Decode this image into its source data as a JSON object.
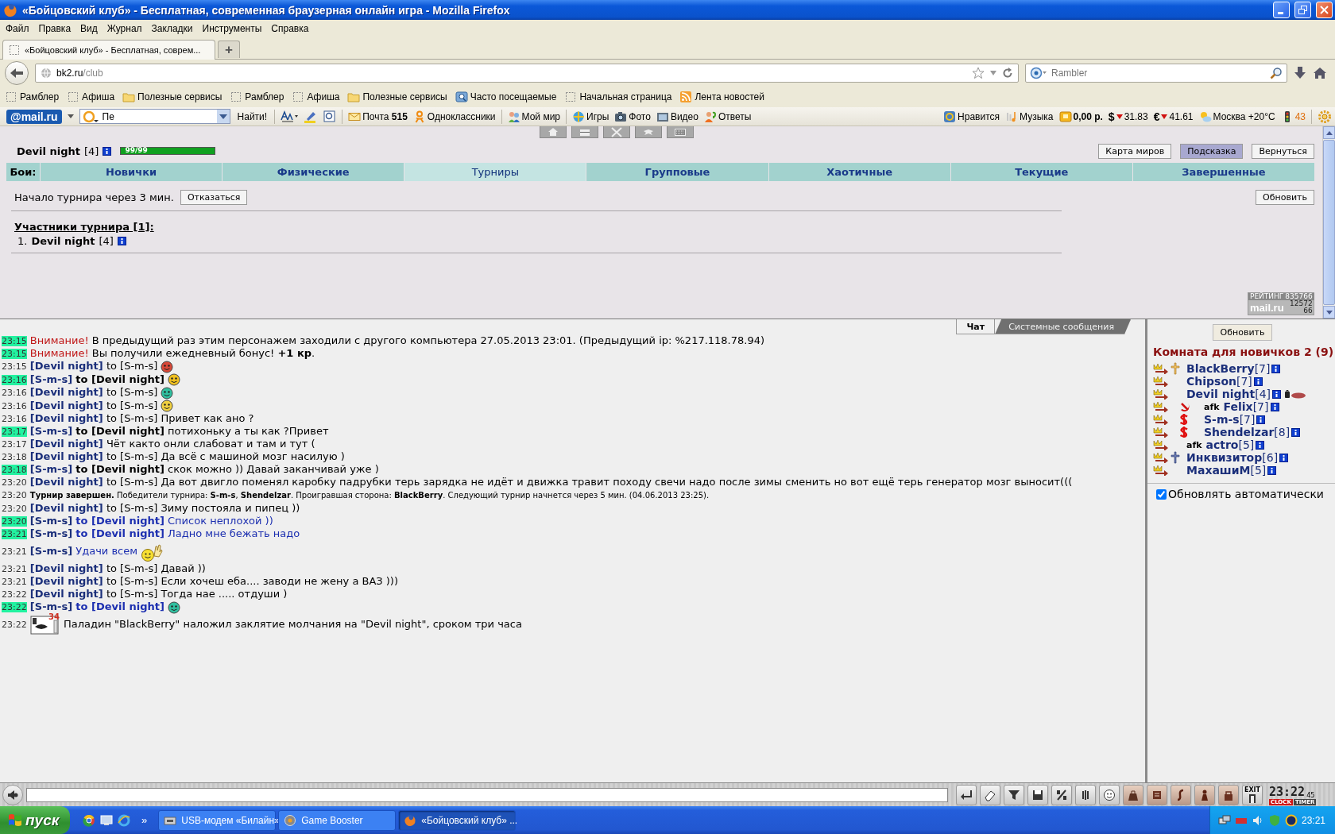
{
  "window": {
    "title": "«Бойцовский клуб» - Бесплатная, современная браузерная онлайн игра - Mozilla Firefox"
  },
  "menu": [
    "Файл",
    "Правка",
    "Вид",
    "Журнал",
    "Закладки",
    "Инструменты",
    "Справка"
  ],
  "tab": {
    "title": "«Бойцовский клуб» - Бесплатная, соврем...",
    "new_tab": "+"
  },
  "address": {
    "host": "bk2.ru",
    "path": "/club"
  },
  "search": {
    "placeholder": "Rambler"
  },
  "bookmarks": [
    {
      "label": "Рамблер",
      "kind": "page"
    },
    {
      "label": "Афиша",
      "kind": "page"
    },
    {
      "label": "Полезные сервисы",
      "kind": "folder"
    },
    {
      "label": "Рамблер",
      "kind": "page"
    },
    {
      "label": "Афиша",
      "kind": "page"
    },
    {
      "label": "Полезные сервисы",
      "kind": "folder"
    },
    {
      "label": "Часто посещаемые",
      "kind": "search"
    },
    {
      "label": "Начальная страница",
      "kind": "page"
    },
    {
      "label": "Лента новостей",
      "kind": "feed"
    }
  ],
  "mail_toolbar": {
    "logo": "@mail.ru",
    "query": "Пе",
    "find": "Найти!",
    "links": [
      {
        "label": "Почта **515**",
        "kind": "mail"
      },
      {
        "label": "Одноклассники",
        "kind": "ok"
      },
      {
        "label": "Мой мир",
        "kind": "world"
      },
      {
        "label": "Игры",
        "kind": "games"
      },
      {
        "label": "Фото",
        "kind": "photo"
      },
      {
        "label": "Видео",
        "kind": "video"
      },
      {
        "label": "Ответы",
        "kind": "answers"
      }
    ],
    "widgets": [
      {
        "label": "Нравится",
        "kind": "like"
      },
      {
        "label": "Музыка",
        "kind": "music"
      },
      {
        "label": "0,00 р.",
        "kind": "wallet"
      },
      {
        "label": "31.83",
        "kind": "currency",
        "symbol": "$"
      },
      {
        "label": "41.61",
        "kind": "currency",
        "symbol": "€"
      },
      {
        "label": "Москва +20°C",
        "kind": "weather"
      },
      {
        "label": "43",
        "kind": "traffic"
      }
    ]
  },
  "game": {
    "player": {
      "name": "Devil night",
      "level": "[4]"
    },
    "hp": {
      "reading": "99/99",
      "level": 1
    },
    "buttons": [
      {
        "label": "Карта миров",
        "selected": false
      },
      {
        "label": "Подсказка",
        "selected": true
      },
      {
        "label": "Вернуться",
        "selected": false
      }
    ],
    "fights_label": "Бои:",
    "fight_tabs": [
      {
        "label": "Новички",
        "selected": false
      },
      {
        "label": "Физические",
        "selected": false
      },
      {
        "label": "Турниры",
        "selected": true
      },
      {
        "label": "Групповые",
        "selected": false
      },
      {
        "label": "Хаотичные",
        "selected": false
      },
      {
        "label": "Текущие",
        "selected": false
      },
      {
        "label": "Завершенные",
        "selected": false
      }
    ],
    "notice": "Начало турнира через 3 мин.",
    "cancel": "Отказаться",
    "refresh": "Обновить",
    "participants_title": "Участники турнира [1]:",
    "participants": [
      {
        "number": "1.",
        "name": "Devil night",
        "level": "[4]"
      }
    ],
    "rating": {
      "label": "РЕЙТИНГ",
      "values": [
        "835766",
        "12572",
        "66"
      ],
      "logo": "mail.ru"
    }
  },
  "chat": {
    "tabs": [
      {
        "label": "Чат",
        "selected": true
      },
      {
        "label": "Системные сообщения",
        "selected": false
      }
    ],
    "messages": [
      {
        "time": "23:15",
        "time_marked": true,
        "kind": "warning",
        "label": "Внимание!",
        "text": "В предыдущий раз этим персонажем заходили с другого компьютера 27.05.2013 23:01. (Предыдущий ip: %217.118.78.94)"
      },
      {
        "time": "23:15",
        "time_marked": true,
        "kind": "warning",
        "label": "Внимание!",
        "text": "Вы получили ежедневный бонус! **+1 кр**."
      },
      {
        "time": "23:15",
        "time_marked": false,
        "kind": "message",
        "sender": "[Devil night]",
        "recipient": "to [S-m-s]",
        "recipient_bold": false,
        "color": "#000000",
        "smiley": {
          "kind": "face"
        }
      },
      {
        "time": "23:16",
        "time_marked": true,
        "kind": "message",
        "sender": "[S-m-s]",
        "recipient": "to [Devil night]",
        "recipient_bold": true,
        "color": "#000000",
        "smiley": {
          "kind": "face"
        }
      },
      {
        "time": "23:16",
        "time_marked": false,
        "kind": "message",
        "sender": "[Devil night]",
        "recipient": "to [S-m-s]",
        "recipient_bold": false,
        "color": "#000000",
        "smiley": {
          "kind": "face"
        }
      },
      {
        "time": "23:16",
        "time_marked": false,
        "kind": "message",
        "sender": "[Devil night]",
        "recipient": "to [S-m-s]",
        "recipient_bold": false,
        "color": "#000000",
        "smiley": {
          "kind": "face"
        }
      },
      {
        "time": "23:16",
        "time_marked": false,
        "kind": "message",
        "sender": "[Devil night]",
        "recipient": "to [S-m-s]",
        "recipient_bold": false,
        "color": "#000000",
        "text": "Привет как ано ?"
      },
      {
        "time": "23:17",
        "time_marked": true,
        "kind": "message",
        "sender": "[S-m-s]",
        "recipient": "to [Devil night]",
        "recipient_bold": true,
        "color": "#000000",
        "text": "потихоньку а ты как ?Привет"
      },
      {
        "time": "23:17",
        "time_marked": false,
        "kind": "message",
        "sender": "[Devil night]",
        "color": "#000000",
        "text": "Чёт както онли слабоват и там и тут ("
      },
      {
        "time": "23:18",
        "time_marked": false,
        "kind": "message",
        "sender": "[Devil night]",
        "recipient": "to [S-m-s]",
        "recipient_bold": false,
        "color": "#000000",
        "text": "Да всё с машиной мозг насилую )"
      },
      {
        "time": "23:18",
        "time_marked": true,
        "kind": "message",
        "sender": "[S-m-s]",
        "recipient": "to [Devil night]",
        "recipient_bold": true,
        "color": "#000000",
        "text": "скок можно )) Давай заканчивай уже )"
      },
      {
        "time": "23:20",
        "time_marked": false,
        "kind": "message",
        "sender": "[Devil night]",
        "recipient": "to [S-m-s]",
        "recipient_bold": false,
        "color": "#000000",
        "text": "Да вот двигло поменял каробку падрубки терь зарядка не идёт и движка травит походу свечи надо после зимы сменить но вот ещё терь генератор мозг выносит((("
      },
      {
        "time": "23:20",
        "time_marked": false,
        "kind": "tournament",
        "text": "**Турнир завершен.** Победители турнира: **S-m-s**, **Shendelzar**. Проигравшая сторона: **BlackBerry**. Следующий турнир начнется через 5 мин. (04.06.2013 23:25)."
      },
      {
        "time": "23:20",
        "time_marked": false,
        "kind": "message",
        "sender": "[Devil night]",
        "recipient": "to [S-m-s]",
        "recipient_bold": false,
        "color": "#000000",
        "text": "Зиму постояла и пипец ))"
      },
      {
        "time": "23:20",
        "time_marked": true,
        "kind": "message",
        "sender": "[S-m-s]",
        "recipient": "to [Devil night]",
        "recipient_bold": true,
        "color": "#1c2fb0",
        "text": "Список неплохой ))"
      },
      {
        "time": "23:21",
        "time_marked": true,
        "kind": "message",
        "sender": "[S-m-s]",
        "recipient": "to [Devil night]",
        "recipient_bold": true,
        "color": "#1c2fb0",
        "text": "Ладно мне бежать надо"
      },
      {
        "time": "23:21",
        "time_marked": false,
        "kind": "message",
        "sender": "[S-m-s]",
        "color": "#1c2fb0",
        "text": "Удачи всем",
        "smiley": {
          "kind": "wave"
        }
      },
      {
        "time": "23:21",
        "time_marked": false,
        "kind": "message",
        "sender": "[Devil night]",
        "recipient": "to [S-m-s]",
        "recipient_bold": false,
        "color": "#000000",
        "text": "Давай ))"
      },
      {
        "time": "23:21",
        "time_marked": false,
        "kind": "message",
        "sender": "[Devil night]",
        "recipient": "to [S-m-s]",
        "recipient_bold": false,
        "color": "#000000",
        "text": "Если хочеш еба.... заводи не жену а ВАЗ )))"
      },
      {
        "time": "23:22",
        "time_marked": false,
        "kind": "message",
        "sender": "[Devil night]",
        "recipient": "to [S-m-s]",
        "recipient_bold": false,
        "color": "#000000",
        "text": "Тогда нае ..... отдуши )"
      },
      {
        "time": "23:22",
        "time_marked": true,
        "kind": "message",
        "sender": "[S-m-s]",
        "recipient": "to [Devil night]",
        "recipient_bold": true,
        "color": "#1c2fb0",
        "smiley": {
          "kind": "face"
        }
      },
      {
        "time": "23:22",
        "time_marked": false,
        "kind": "spell",
        "badge": "34",
        "text": "Паладин \"BlackBerry\" наложил заклятие молчания на \"Devil night\", сроком три часа"
      }
    ]
  },
  "room": {
    "refresh": "Обновить",
    "title": "Комната для новичков 2 (9)",
    "users": [
      {
        "name": "BlackBerry",
        "level": "[7]",
        "kind": "light-cross",
        "silenced": false
      },
      {
        "name": "Chipson",
        "level": "[7]",
        "kind": "plain",
        "silenced": false
      },
      {
        "name": "Devil night",
        "level": "[4]",
        "kind": "plain",
        "silenced": true
      },
      {
        "name": "Felix",
        "level": "[7]",
        "kind": "sickle",
        "status": "afk",
        "silenced": false
      },
      {
        "name": "S-m-s",
        "level": "[7]",
        "kind": "dollar",
        "silenced": false
      },
      {
        "name": "Shendelzar",
        "level": "[8]",
        "kind": "dollar",
        "silenced": false
      },
      {
        "name": "actro",
        "level": "[5]",
        "kind": "plain",
        "status": "afk",
        "silenced": false
      },
      {
        "name": "Инквизитор",
        "level": "[6]",
        "kind": "dark-cross",
        "silenced": false
      },
      {
        "name": "МахашиМ",
        "level": "[5]",
        "kind": "plain",
        "silenced": false
      }
    ],
    "auto_refresh": {
      "label": "Обновлять автоматически",
      "checked": true
    }
  },
  "input_bar": {
    "exit": "EXIT",
    "clock": {
      "time": "23:22",
      "seconds": "45",
      "modes": [
        "CLOCK",
        "TIMER"
      ]
    }
  },
  "taskbar": {
    "start": "пуск",
    "more": "»",
    "tasks": [
      {
        "label": "USB-модем «Билайн»",
        "kind": "modem",
        "selected": false
      },
      {
        "label": "Game Booster",
        "kind": "booster",
        "selected": false
      },
      {
        "label": "«Бойцовский клуб» ...",
        "kind": "browser",
        "selected": true
      }
    ],
    "time": "23:21"
  }
}
